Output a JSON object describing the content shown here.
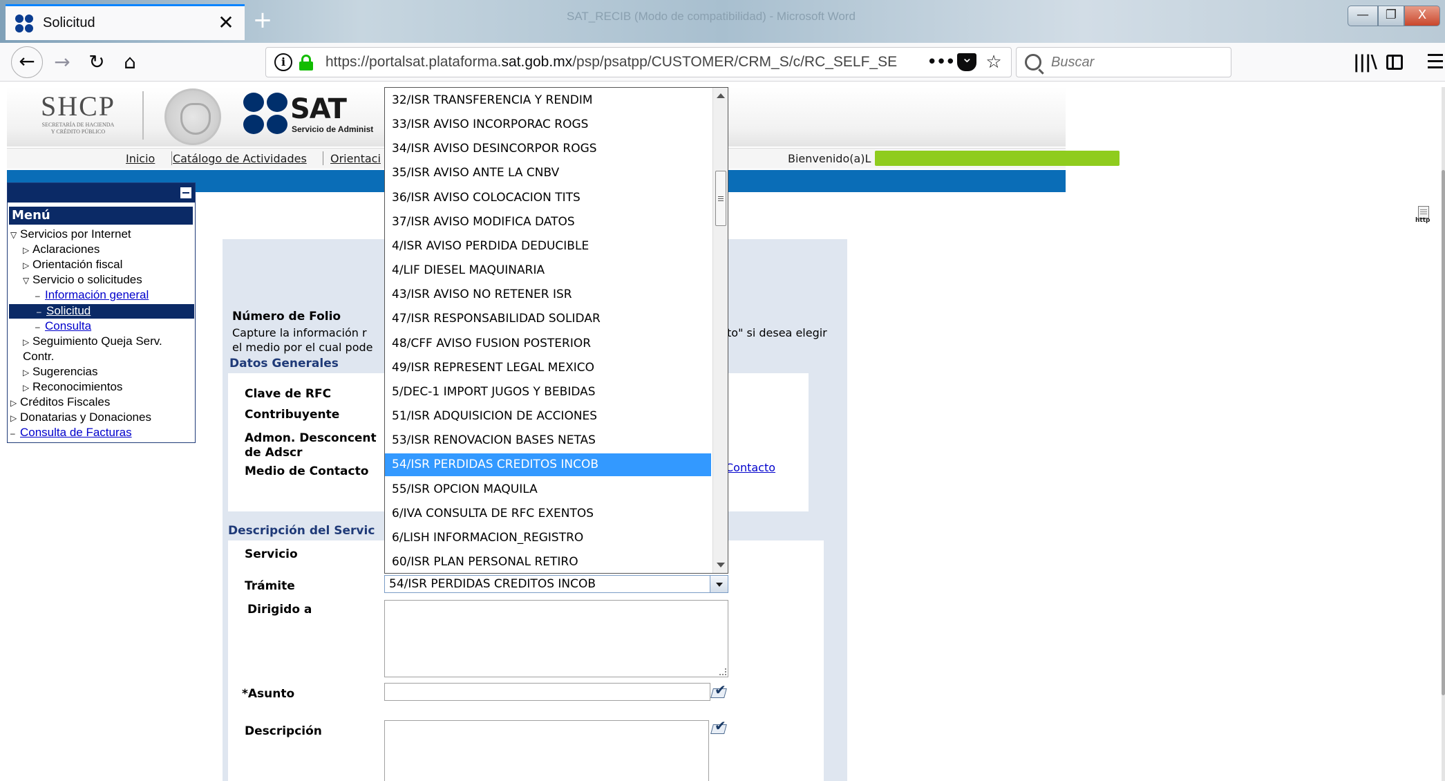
{
  "browser": {
    "tab_title": "Solicitud",
    "tab_close": "✕",
    "new_tab": "+",
    "window_title": "SAT_RECIB (Modo de compatibilidad) - Microsoft Word",
    "url_prefix": "https://portalsat.plataforma.",
    "url_domain": "sat.gob.mx",
    "url_suffix": "/psp/psatpp/CUSTOMER/CRM_S/c/RC_SELF_SE",
    "url_more": "•••",
    "search_placeholder": "Buscar",
    "library_icon": "|||\\",
    "win_min": "—",
    "win_max": "❐",
    "win_close": "X"
  },
  "header": {
    "shcp": "SHCP",
    "shcp_sub1": "SECRETARÍA DE HACIENDA",
    "shcp_sub2": "Y CRÉDITO PÚBLICO",
    "sat": "SAT",
    "sat_sub": "Servicio de Administ"
  },
  "topnav": {
    "links": [
      "Inicio",
      "Catálogo de Actividades",
      "Orientaci"
    ],
    "welcome": "Bienvenido(a)L"
  },
  "http_icon_label": "http",
  "menu": {
    "title": "Menú",
    "items": [
      {
        "label": "Servicios por Internet",
        "tri": "▽"
      },
      {
        "label": "Aclaraciones",
        "tri": "▷"
      },
      {
        "label": "Orientación fiscal",
        "tri": "▷"
      },
      {
        "label": "Servicio o solicitudes",
        "tri": "▽"
      },
      {
        "label": "Información general",
        "tri": "–"
      },
      {
        "label": "Solicitud",
        "tri": "–"
      },
      {
        "label": "Consulta",
        "tri": "–"
      },
      {
        "label": "Seguimiento Queja Serv.",
        "tri": "▷"
      },
      {
        "label": "Contr."
      },
      {
        "label": "Sugerencias",
        "tri": "▷"
      },
      {
        "label": "Reconocimientos",
        "tri": "▷"
      },
      {
        "label": "Créditos Fiscales",
        "tri": "▷"
      },
      {
        "label": "Donatarias y Donaciones",
        "tri": "▷"
      },
      {
        "label": "Consulta de Facturas",
        "tri": "–"
      }
    ]
  },
  "form": {
    "folio_label": "Número de Folio",
    "instr_line1_left": "Capture la información r",
    "instr_line1_right": "to\" si desea elegir",
    "instr_line2_left": "el medio por el cual pode",
    "datos_generales": "Datos Generales",
    "clave_rfc": "Clave de RFC",
    "contribuyente": "Contribuyente",
    "admon_line1": "Admon. Desconcent",
    "admon_line2": "de Adscr",
    "medio_contacto": "Medio de Contacto",
    "contacto_link": "Contacto",
    "descripcion_servicio": "Descripción del Servic",
    "servicio": "Servicio",
    "tramite": "Trámite",
    "tramite_value": "54/ISR PERDIDAS CREDITOS INCOB",
    "dirigido": "Dirigido a",
    "asunto": "*Asunto",
    "descripcion": "Descripción"
  },
  "dropdown": {
    "options": [
      "32/ISR TRANSFERENCIA Y RENDIM",
      "33/ISR AVISO INCORPORAC ROGS",
      "34/ISR AVISO DESINCORPOR ROGS",
      "35/ISR AVISO ANTE LA CNBV",
      "36/ISR AVISO COLOCACION TITS",
      "37/ISR AVISO MODIFICA DATOS",
      "4/ISR AVISO PERDIDA DEDUCIBLE",
      "4/LIF DIESEL MAQUINARIA",
      "43/ISR AVISO NO RETENER ISR",
      "47/ISR RESPONSABILIDAD SOLIDAR",
      "48/CFF AVISO FUSION POSTERIOR",
      "49/ISR REPRESENT LEGAL MEXICO",
      "5/DEC-1 IMPORT JUGOS Y BEBIDAS",
      "51/ISR ADQUISICION DE ACCIONES",
      "53/ISR RENOVACION BASES NETAS",
      "54/ISR PERDIDAS CREDITOS INCOB",
      "55/ISR OPCION MAQUILA",
      "6/IVA CONSULTA DE RFC EXENTOS",
      "6/LISH INFORMACION_REGISTRO",
      "60/ISR PLAN PERSONAL RETIRO"
    ],
    "highlighted": "54/ISR PERDIDAS CREDITOS INCOB"
  }
}
